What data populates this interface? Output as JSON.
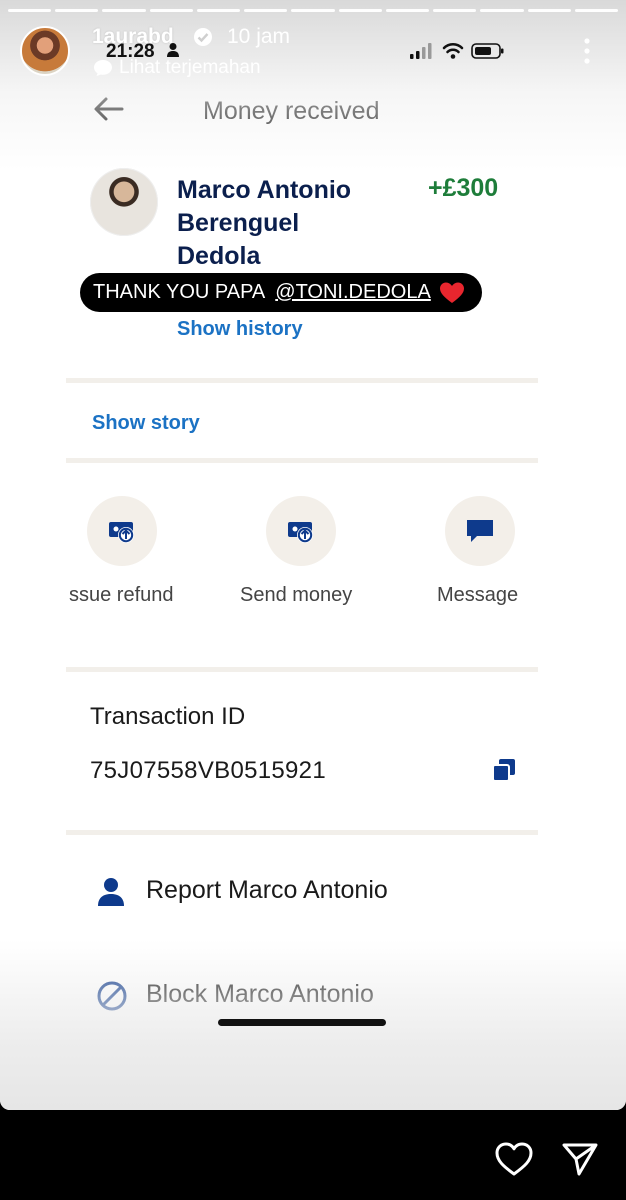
{
  "instagram": {
    "username": "1aurabd",
    "posted_ago": "10 jam",
    "translate_label": "Lihat terjemahan",
    "progress_segments": 13
  },
  "status_bar": {
    "time": "21:28"
  },
  "header": {
    "title": "Money received"
  },
  "transaction": {
    "name_lines": [
      "Marco Antonio",
      "Berenguel",
      "Dedola"
    ],
    "amount": "+£300",
    "caption": "THANK YOU PAPA",
    "caption_mention": "@TONI.DEDOLA",
    "show_history": "Show history",
    "show_story": "Show story",
    "actions": [
      {
        "label": "ssue refund",
        "icon": "refund-icon"
      },
      {
        "label": "Send money",
        "icon": "send-money-icon"
      },
      {
        "label": "Message",
        "icon": "message-icon"
      }
    ],
    "id_label": "Transaction ID",
    "id_value": "75J07558VB0515921",
    "report_label": "Report Marco Antonio",
    "block_label": "Block Marco Antonio"
  },
  "colors": {
    "navy": "#0b1f4d",
    "link_blue": "#1b72c4",
    "amount_green": "#1e7d3a",
    "icon_blue": "#0e3a8c"
  }
}
